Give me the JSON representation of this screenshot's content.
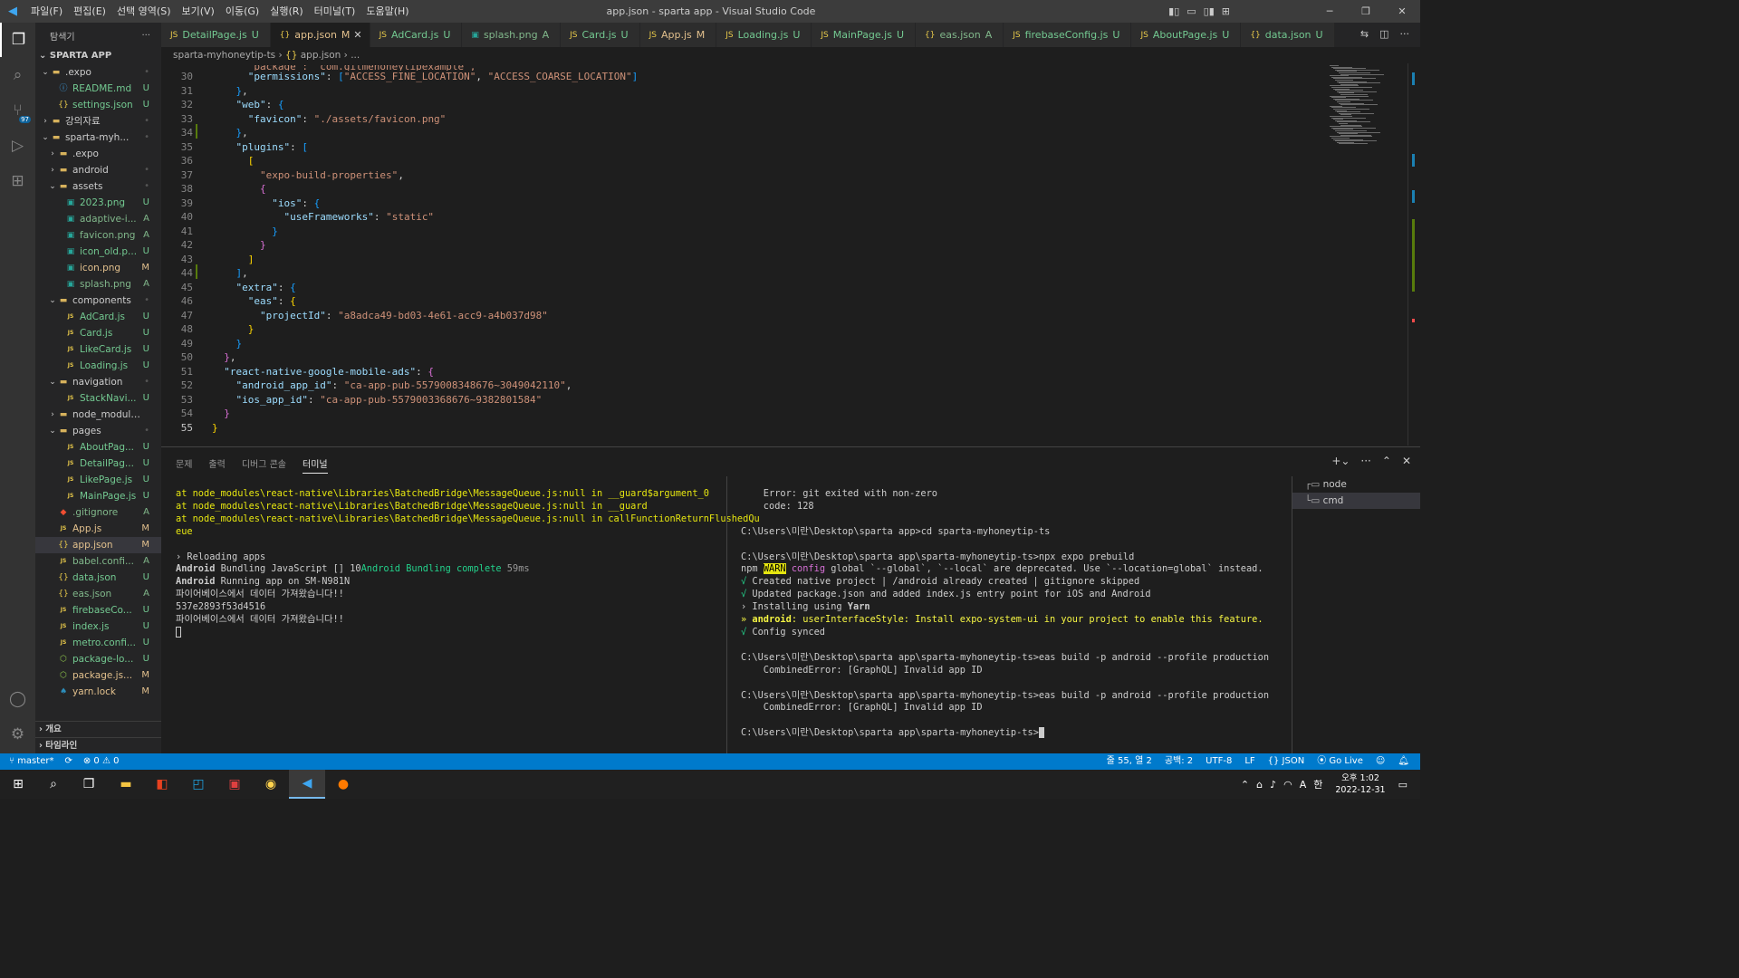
{
  "titlebar": {
    "menus": [
      "파일(F)",
      "편집(E)",
      "선택 영역(S)",
      "보기(V)",
      "이동(G)",
      "실행(R)",
      "터미널(T)",
      "도움말(H)"
    ],
    "title": "app.json - sparta app - Visual Studio Code"
  },
  "sidebar": {
    "header": "탐색기",
    "root": "SPARTA APP",
    "tree": [
      {
        "label": ".expo",
        "depth": 0,
        "type": "folder",
        "open": true,
        "status": "•"
      },
      {
        "label": "README.md",
        "depth": 1,
        "type": "info",
        "status": "U"
      },
      {
        "label": "settings.json",
        "depth": 1,
        "type": "json",
        "status": "U"
      },
      {
        "label": "강의자료",
        "depth": 0,
        "type": "folder",
        "open": false,
        "status": "•"
      },
      {
        "label": "sparta-myh...",
        "depth": 0,
        "type": "folder",
        "open": true,
        "status": "•"
      },
      {
        "label": ".expo",
        "depth": 1,
        "type": "folder",
        "open": false,
        "status": ""
      },
      {
        "label": "android",
        "depth": 1,
        "type": "folder",
        "open": false,
        "status": "•"
      },
      {
        "label": "assets",
        "depth": 1,
        "type": "folder",
        "open": true,
        "status": "•"
      },
      {
        "label": "2023.png",
        "depth": 2,
        "type": "img",
        "status": "U"
      },
      {
        "label": "adaptive-i...",
        "depth": 2,
        "type": "img",
        "status": "A"
      },
      {
        "label": "favicon.png",
        "depth": 2,
        "type": "img",
        "status": "A"
      },
      {
        "label": "icon_old.p...",
        "depth": 2,
        "type": "img",
        "status": "U"
      },
      {
        "label": "icon.png",
        "depth": 2,
        "type": "img",
        "status": "M"
      },
      {
        "label": "splash.png",
        "depth": 2,
        "type": "img",
        "status": "A"
      },
      {
        "label": "components",
        "depth": 1,
        "type": "folder",
        "open": true,
        "status": "•"
      },
      {
        "label": "AdCard.js",
        "depth": 2,
        "type": "js",
        "status": "U"
      },
      {
        "label": "Card.js",
        "depth": 2,
        "type": "js",
        "status": "U"
      },
      {
        "label": "LikeCard.js",
        "depth": 2,
        "type": "js",
        "status": "U"
      },
      {
        "label": "Loading.js",
        "depth": 2,
        "type": "js",
        "status": "U"
      },
      {
        "label": "navigation",
        "depth": 1,
        "type": "folder",
        "open": true,
        "status": "•"
      },
      {
        "label": "StackNavi...",
        "depth": 2,
        "type": "js",
        "status": "U"
      },
      {
        "label": "node_modules",
        "depth": 1,
        "type": "folder",
        "open": false,
        "status": ""
      },
      {
        "label": "pages",
        "depth": 1,
        "type": "folder",
        "open": true,
        "status": "•"
      },
      {
        "label": "AboutPag...",
        "depth": 2,
        "type": "js",
        "status": "U"
      },
      {
        "label": "DetailPag...",
        "depth": 2,
        "type": "js",
        "status": "U"
      },
      {
        "label": "LikePage.js",
        "depth": 2,
        "type": "js",
        "status": "U"
      },
      {
        "label": "MainPage.js",
        "depth": 2,
        "type": "js",
        "status": "U"
      },
      {
        "label": ".gitignore",
        "depth": 1,
        "type": "git",
        "status": "A"
      },
      {
        "label": "App.js",
        "depth": 1,
        "type": "js",
        "status": "M"
      },
      {
        "label": "app.json",
        "depth": 1,
        "type": "json",
        "status": "M",
        "selected": true
      },
      {
        "label": "babel.confi...",
        "depth": 1,
        "type": "js",
        "status": "A"
      },
      {
        "label": "data.json",
        "depth": 1,
        "type": "json",
        "status": "U"
      },
      {
        "label": "eas.json",
        "depth": 1,
        "type": "json",
        "status": "A"
      },
      {
        "label": "firebaseCo...",
        "depth": 1,
        "type": "js",
        "status": "U"
      },
      {
        "label": "index.js",
        "depth": 1,
        "type": "js",
        "status": "U"
      },
      {
        "label": "metro.confi...",
        "depth": 1,
        "type": "js",
        "status": "U"
      },
      {
        "label": "package-lo...",
        "depth": 1,
        "type": "npm",
        "status": "U"
      },
      {
        "label": "package.js...",
        "depth": 1,
        "type": "npm",
        "status": "M"
      },
      {
        "label": "yarn.lock",
        "depth": 1,
        "type": "yarn",
        "status": "M"
      }
    ],
    "footer": [
      "개요",
      "타임라인"
    ]
  },
  "tabs": [
    {
      "name": "DetailPage.js",
      "status": "U",
      "icon": "js"
    },
    {
      "name": "app.json",
      "status": "M",
      "icon": "json",
      "active": true
    },
    {
      "name": "AdCard.js",
      "status": "U",
      "icon": "js"
    },
    {
      "name": "splash.png",
      "status": "A",
      "icon": "img"
    },
    {
      "name": "Card.js",
      "status": "U",
      "icon": "js"
    },
    {
      "name": "App.js",
      "status": "M",
      "icon": "js"
    },
    {
      "name": "Loading.js",
      "status": "U",
      "icon": "js"
    },
    {
      "name": "MainPage.js",
      "status": "U",
      "icon": "js"
    },
    {
      "name": "eas.json",
      "status": "A",
      "icon": "json"
    },
    {
      "name": "firebaseConfig.js",
      "status": "U",
      "icon": "js"
    },
    {
      "name": "AboutPage.js",
      "status": "U",
      "icon": "js"
    },
    {
      "name": "data.json",
      "status": "U",
      "icon": "json"
    }
  ],
  "breadcrumb": {
    "folder": "sparta-myhoneytip-ts",
    "file": "app.json",
    "rest": "..."
  },
  "code_lines": [
    {
      "n": 30,
      "t": "      \"permissions\": [\"ACCESS_FINE_LOCATION\", \"ACCESS_COARSE_LOCATION\"]"
    },
    {
      "n": 31,
      "t": "    },"
    },
    {
      "n": 32,
      "t": "    \"web\": {"
    },
    {
      "n": 33,
      "t": "      \"favicon\": \"./assets/favicon.png\""
    },
    {
      "n": 34,
      "t": "    },"
    },
    {
      "n": 35,
      "t": "    \"plugins\": ["
    },
    {
      "n": 36,
      "t": "      ["
    },
    {
      "n": 37,
      "t": "        \"expo-build-properties\","
    },
    {
      "n": 38,
      "t": "        {"
    },
    {
      "n": 39,
      "t": "          \"ios\": {"
    },
    {
      "n": 40,
      "t": "            \"useFrameworks\": \"static\""
    },
    {
      "n": 41,
      "t": "          }"
    },
    {
      "n": 42,
      "t": "        }"
    },
    {
      "n": 43,
      "t": "      ]"
    },
    {
      "n": 44,
      "t": "    ],"
    },
    {
      "n": 45,
      "t": "    \"extra\": {"
    },
    {
      "n": 46,
      "t": "      \"eas\": {"
    },
    {
      "n": 47,
      "t": "        \"projectId\": \"a8adca49-bd03-4e61-acc9-a4b037d98\""
    },
    {
      "n": 48,
      "t": "      }"
    },
    {
      "n": 49,
      "t": "    }"
    },
    {
      "n": 50,
      "t": "  },"
    },
    {
      "n": 51,
      "t": "  \"react-native-google-mobile-ads\": {"
    },
    {
      "n": 52,
      "t": "    \"android_app_id\": \"ca-app-pub-5579008348676~3049042110\","
    },
    {
      "n": 53,
      "t": "    \"ios_app_id\": \"ca-app-pub-5579003368676~9382801584\""
    },
    {
      "n": 54,
      "t": "  }"
    },
    {
      "n": 55,
      "t": "}"
    }
  ],
  "panel": {
    "tabs": [
      "문제",
      "출력",
      "디버그 콘솔",
      "터미널"
    ],
    "active": "터미널",
    "terminal_left": [
      "at node_modules\\react-native\\Libraries\\BatchedBridge\\MessageQueue.js:null in __guard$argument_0",
      "at node_modules\\react-native\\Libraries\\BatchedBridge\\MessageQueue.js:null in __guard",
      "at node_modules\\react-native\\Libraries\\BatchedBridge\\MessageQueue.js:null in callFunctionReturnFlushedQu",
      "eue",
      "",
      "› Reloading apps",
      "Android Bundling JavaScript [] 10Android Bundling complete 59ms",
      "Android Running app on SM-N981N",
      "파이어베이스에서 데이터 가져왔습니다!!",
      "537e2893f53d4516",
      "파이어베이스에서 데이터 가져왔습니다!!"
    ],
    "terminal_right": [
      "    Error: git exited with non-zero",
      "    code: 128",
      "",
      "C:\\Users\\미란\\Desktop\\sparta app>cd sparta-myhoneytip-ts",
      "",
      "C:\\Users\\미란\\Desktop\\sparta app\\sparta-myhoneytip-ts>npx expo prebuild",
      "npm WARN config global `--global`, `--local` are deprecated. Use `--location=global` instead.",
      "√ Created native project | /android already created | gitignore skipped",
      "√ Updated package.json and added index.js entry point for iOS and Android",
      "› Installing using Yarn",
      "» android: userInterfaceStyle: Install expo-system-ui in your project to enable this feature.",
      "√ Config synced",
      "",
      "C:\\Users\\미란\\Desktop\\sparta app\\sparta-myhoneytip-ts>eas build -p android --profile production",
      "    CombinedError: [GraphQL] Invalid app ID",
      "",
      "C:\\Users\\미란\\Desktop\\sparta app\\sparta-myhoneytip-ts>eas build -p android --profile production",
      "    CombinedError: [GraphQL] Invalid app ID",
      "",
      "C:\\Users\\미란\\Desktop\\sparta app\\sparta-myhoneytip-ts>"
    ],
    "terminal_list": [
      "node",
      "cmd"
    ]
  },
  "statusbar": {
    "branch": "master*",
    "errors": "0",
    "warnings": "0",
    "position": "줄 55, 열 2",
    "spaces": "공백: 2",
    "encoding": "UTF-8",
    "eol": "LF",
    "language": "JSON",
    "golive": "Go Live"
  },
  "taskbar": {
    "time": "오후 1:02",
    "date": "2022-12-31",
    "lang": "A"
  },
  "activity": {
    "scm_badge": "97"
  }
}
